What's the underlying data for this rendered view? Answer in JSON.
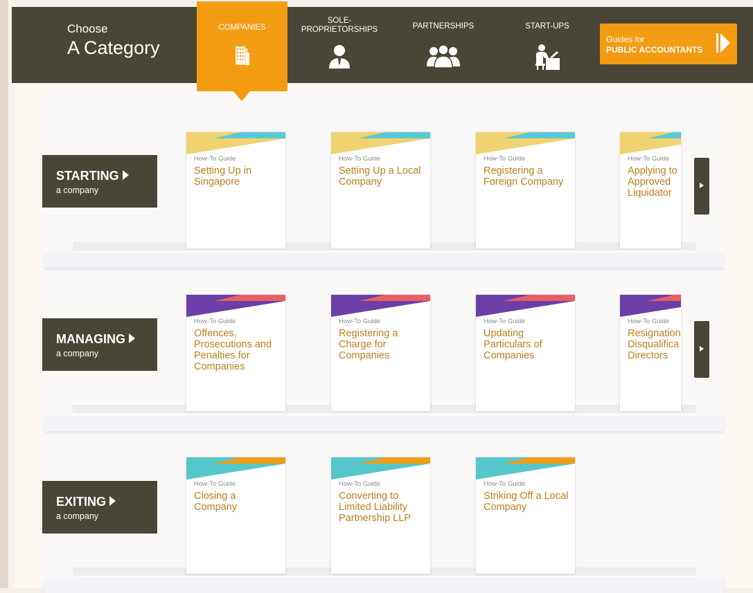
{
  "header": {
    "choose_line1": "Choose",
    "choose_line2": "A Category",
    "categories": [
      {
        "label": "COMPANIES",
        "icon": "building-icon",
        "active": true
      },
      {
        "label": "SOLE-\nPROPRIETORSHIPS",
        "icon": "person-icon",
        "active": false
      },
      {
        "label": "PARTNERSHIPS",
        "icon": "group-icon",
        "active": false
      },
      {
        "label": "START-UPS",
        "icon": "desk-worker-icon",
        "active": false
      }
    ],
    "accountants_button": {
      "small": "Guides for",
      "big": "PUBLIC ACCOUNTANTS",
      "icon": "play-arrow-icon"
    }
  },
  "colors": {
    "dark": "#4a4637",
    "accent": "#f39c12",
    "title_text": "#c07d1a",
    "row1_caps": [
      "#f0d270",
      "#5bc8d6"
    ],
    "row2_caps": [
      "#6a3fa8",
      "#ea5f62"
    ],
    "row3_caps": [
      "#55c7cc",
      "#f39c12"
    ]
  },
  "rows": [
    {
      "title": "STARTING",
      "subtitle": "a company",
      "cards": [
        {
          "kind": "How-To Guide",
          "name": "Setting Up in Singapore"
        },
        {
          "kind": "How-To Guide",
          "name": "Setting Up a Local Company"
        },
        {
          "kind": "How-To Guide",
          "name": "Registering a Foreign Company"
        },
        {
          "kind": "How-To Guide",
          "name": "Applying to Approved Liquidator"
        }
      ]
    },
    {
      "title": "MANAGING",
      "subtitle": "a company",
      "cards": [
        {
          "kind": "How-To Guide",
          "name": "Offences, Prosecutions and Penalties for Companies"
        },
        {
          "kind": "How-To Guide",
          "name": "Registering a Charge for Companies"
        },
        {
          "kind": "How-To Guide",
          "name": "Updating Particulars of Companies"
        },
        {
          "kind": "How-To Guide",
          "name": "Resignation Disqualifica Directors"
        }
      ]
    },
    {
      "title": "EXITING",
      "subtitle": "a company",
      "cards": [
        {
          "kind": "How-To Guide",
          "name": "Closing a Company"
        },
        {
          "kind": "How-To Guide",
          "name": "Converting to Limited Liability Partnership LLP"
        },
        {
          "kind": "How-To Guide",
          "name": "Striking Off a Local Company"
        }
      ]
    }
  ]
}
